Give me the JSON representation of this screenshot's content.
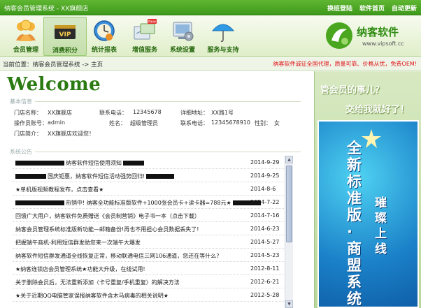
{
  "titlebar": {
    "title": "纳客会员管理系统 - XX旗舰店",
    "links": [
      "换班登陆",
      "软件首页",
      "自动更新"
    ]
  },
  "toolbar": {
    "items": [
      {
        "label": "会员管理",
        "icon": "members-icon"
      },
      {
        "label": "消费积分",
        "icon": "vip-card-icon"
      },
      {
        "label": "统计报表",
        "icon": "clock-report-icon"
      },
      {
        "label": "增值服务",
        "icon": "value-added-service-icon",
        "badge": "New"
      },
      {
        "label": "系统设置",
        "icon": "settings-icon"
      },
      {
        "label": "服务与支持",
        "icon": "umbrella-support-icon"
      }
    ],
    "logo": {
      "brand": "纳客软件",
      "url": "www.vipsoft.cc"
    }
  },
  "breadcrumb": {
    "text": "当前位置：纳客会员管理系统 -> 主页",
    "notice": "纳客软件诚征全国代理，质量可靠、价格从优，免费OEM!"
  },
  "welcome": "Welcome",
  "basic_info": {
    "title": "基本信息",
    "store_name_label": "门店名称：",
    "store_name": "XX旗舰店",
    "phone_label": "联系电话：",
    "phone": "12345678",
    "address_label": "详细地址：",
    "address": "XX路1号",
    "operator_label": "操作员账号：",
    "operator": "admin",
    "name_label": "姓名：",
    "name": "超级管理员",
    "contact_label": "联系电话：",
    "contact": "12345678910",
    "gender_label": "性别：",
    "gender": "女",
    "intro_label": "门店简介：",
    "intro": "XX旗舰店欢迎您！"
  },
  "announcements": {
    "title": "系统公告",
    "rows": [
      {
        "pre_redact": 70,
        "text": "纳客软件短信使用须知",
        "post_redact": 30,
        "date": "2014-9-29"
      },
      {
        "pre_redact": 44,
        "text": "国庆钜惠，纳客软件短信活动强势回归!",
        "post_redact": 40,
        "date": "2014-9-25"
      },
      {
        "pre_redact": 0,
        "text": "★单机版视频教程发布，点击查看★",
        "post_redact": 0,
        "date": "2014-8-6"
      },
      {
        "pre_redact": 70,
        "text": "热销中! 纳客全功能标准版软件+1000张会员卡+读卡器=788元★",
        "post_redact": 40,
        "date": "2014-7-22"
      },
      {
        "pre_redact": 0,
        "text": "回馈广大用户，纳客软件免费赠送《会员制营销》电子书一本（点击下载）",
        "post_redact": 0,
        "date": "2014-7-16"
      },
      {
        "pre_redact": 0,
        "text": "纳客会员管理系统标准版新功能—邮箱备份!再也不用担心会员数据丢失了!",
        "post_redact": 0,
        "date": "2014-6-23"
      },
      {
        "pre_redact": 0,
        "text": "把握端午商机-利用短信群发助您来一次端午大爆发",
        "post_redact": 0,
        "date": "2014-5-27"
      },
      {
        "pre_redact": 0,
        "text": "纳客软件短信群发通道全线恢复正常，移动联通电信三网106通道，您还在等什么?",
        "post_redact": 0,
        "date": "2014-5-23"
      },
      {
        "pre_redact": 0,
        "text": "★纳客连锁店会员管理系统★功能大升级，在线试用!",
        "post_redact": 0,
        "date": "2012-8-11"
      },
      {
        "pre_redact": 0,
        "text": "关于删除会员后，无法重新添加〈卡号重复/手机重复〉的解决方法",
        "post_redact": 0,
        "date": "2012-6-21"
      },
      {
        "pre_redact": 0,
        "text": "★关于近期QQ电脑管家误报纳客软件含木马病毒的相关说明★",
        "post_redact": 0,
        "date": "2012-5-28"
      }
    ]
  },
  "ad": {
    "slogan1": "管会员的事儿？",
    "slogan2": "交给我就好了！",
    "vertical1": "全新标准版·商盟系统",
    "vertical2": "璀璨上线"
  },
  "colors": {
    "brand_green": "#2e8b10",
    "notice_red": "#e0151b",
    "ad_blue": "#1b82c9"
  }
}
